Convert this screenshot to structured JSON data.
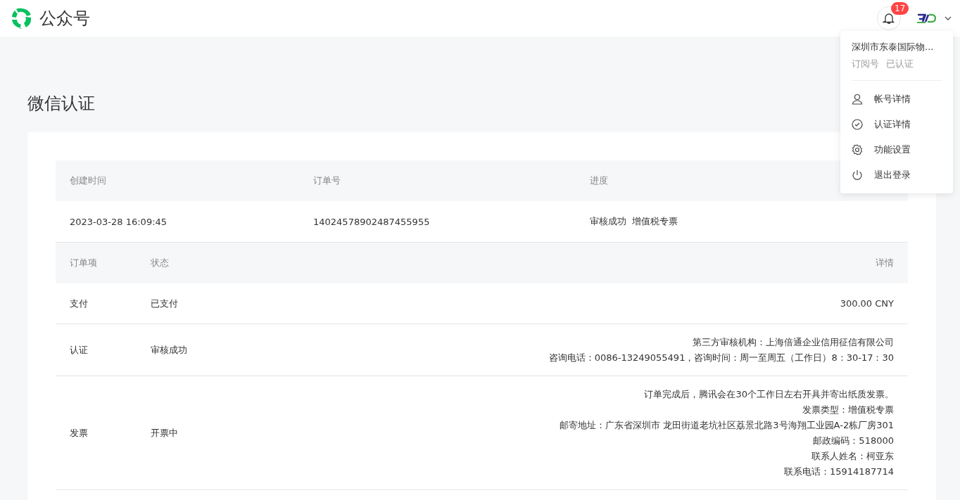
{
  "header": {
    "brand": "公众号",
    "notifications": {
      "count": "17"
    }
  },
  "account_menu": {
    "open": true,
    "name": "深圳市东泰国际物...",
    "type": "订阅号",
    "status": "已认证",
    "items": [
      {
        "kind": "user",
        "label": "帐号详情"
      },
      {
        "kind": "check",
        "label": "认证详情"
      },
      {
        "kind": "gear",
        "label": "功能设置"
      },
      {
        "kind": "power",
        "label": "退出登录"
      }
    ]
  },
  "page_title": "微信认证",
  "order": {
    "columns": [
      "创建时间",
      "订单号",
      "进度"
    ],
    "row": [
      "2023-03-28 16:09:45",
      "14024578902487455955",
      "审核成功  增值税专票"
    ]
  },
  "items_table": {
    "columns": [
      "订单项",
      "状态",
      "详情"
    ],
    "rows": [
      {
        "item": "支付",
        "status": "已支付",
        "details": [
          "300.00 CNY"
        ]
      },
      {
        "item": "认证",
        "status": "审核成功",
        "details": [
          "第三方审核机构：上海倍通企业信用征信有限公司",
          "咨询电话：0086-13249055491，咨询时间：周一至周五（工作日）8：30-17：30"
        ]
      },
      {
        "item": "发票",
        "status": "开票中",
        "details": [
          "订单完成后，腾讯会在30个工作日左右开具并寄出纸质发票。",
          "发票类型：增值税专票",
          "邮寄地址：广东省深圳市 龙田街道老坑社区荔景北路3号海翔工业园A-2栋厂房301",
          "邮政编码：518000",
          "联系人姓名：柯亚东",
          "联系电话：15914187714"
        ]
      }
    ]
  }
}
